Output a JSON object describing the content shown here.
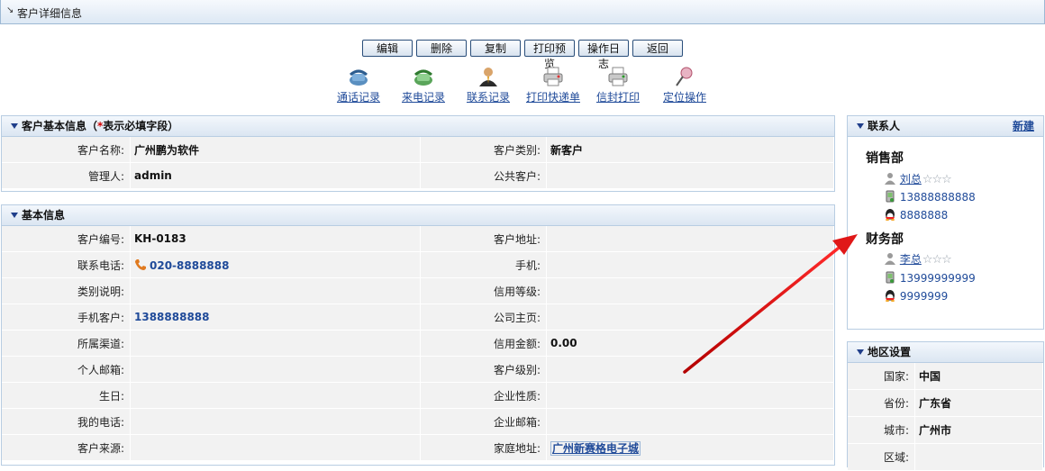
{
  "page": {
    "title": "客户详细信息"
  },
  "toolbar": {
    "buttons": [
      "编辑",
      "删除",
      "复制",
      "打印预览",
      "操作日志",
      "返回"
    ]
  },
  "tools": [
    {
      "label": "通话记录",
      "icon": "phone-call-icon"
    },
    {
      "label": "来电记录",
      "icon": "incoming-call-icon"
    },
    {
      "label": "联系记录",
      "icon": "contact-person-icon"
    },
    {
      "label": "打印快递单",
      "icon": "printer-icon"
    },
    {
      "label": "信封打印",
      "icon": "envelope-printer-icon"
    },
    {
      "label": "定位操作",
      "icon": "pushpin-icon"
    }
  ],
  "basic_panel": {
    "title_prefix": "客户基本信息（",
    "required_mark": "*",
    "title_suffix": "表示必填字段）",
    "rows": [
      [
        "客户名称:",
        "广州鹏为软件",
        "客户类别:",
        "新客户"
      ],
      [
        "管理人:",
        "admin",
        "公共客户:",
        ""
      ]
    ]
  },
  "info_panel": {
    "title": "基本信息",
    "rows": [
      [
        "客户编号:",
        "KH-0183",
        "客户地址:",
        ""
      ],
      [
        "联系电话:",
        "020-8888888",
        "手机:",
        ""
      ],
      [
        "类别说明:",
        "",
        "信用等级:",
        ""
      ],
      [
        "手机客户:",
        "1388888888",
        "公司主页:",
        ""
      ],
      [
        "所属渠道:",
        "",
        "信用金额:",
        "0.00"
      ],
      [
        "个人邮箱:",
        "",
        "客户级别:",
        ""
      ],
      [
        "生日:",
        "",
        "企业性质:",
        ""
      ],
      [
        "我的电话:",
        "",
        "企业邮箱:",
        ""
      ],
      [
        "客户来源:",
        "",
        "家庭地址:",
        "广州新赛格电子城"
      ]
    ]
  },
  "contacts_panel": {
    "title": "联系人",
    "new_label": "新建",
    "departments": [
      {
        "name": "销售部",
        "person": "刘总",
        "stars": "☆☆☆",
        "mobile": "13888888888",
        "qq": "8888888"
      },
      {
        "name": "财务部",
        "person": "李总",
        "stars": "☆☆☆",
        "mobile": "13999999999",
        "qq": "9999999"
      }
    ]
  },
  "region_panel": {
    "title": "地区设置",
    "rows": [
      [
        "国家:",
        "中国"
      ],
      [
        "省份:",
        "广东省"
      ],
      [
        "城市:",
        "广州市"
      ],
      [
        "区域:",
        ""
      ]
    ]
  },
  "colors": {
    "accent": "#1f4a99",
    "panel_border": "#b8cde2",
    "annotation_arrow": "#e01818"
  }
}
